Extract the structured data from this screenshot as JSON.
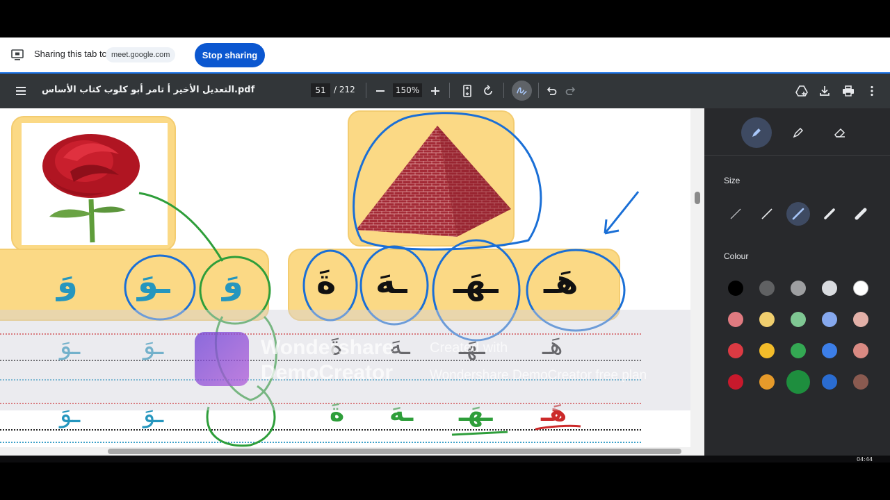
{
  "share_bar": {
    "label": "Sharing this tab to",
    "domain": "meet.google.com",
    "stop_button": "Stop sharing"
  },
  "toolbar": {
    "title": "التعديل الأخير أ تامر أبو كلوب كتاب الأساس.pdf",
    "page_current": "51",
    "page_total": "/ 212",
    "zoom": "150%",
    "icons": [
      "menu-icon",
      "zoom-out-icon",
      "zoom-in-icon",
      "fit-page-icon",
      "rotate-icon",
      "annotate-icon",
      "undo-icon",
      "redo-icon",
      "add-drive-icon",
      "download-icon",
      "print-icon",
      "more-icon"
    ]
  },
  "side_panel": {
    "tools": [
      "pen-icon",
      "highlighter-icon",
      "eraser-icon"
    ],
    "size_label": "Size",
    "colour_label": "Colour",
    "selected_size": 3,
    "colours": [
      [
        "#000000",
        "#606163",
        "#9e9fa1",
        "#dadce0",
        "#ffffff"
      ],
      [
        "#e07a80",
        "#f0ce6e",
        "#7fc793",
        "#86a8ee",
        "#e2b0a8"
      ],
      [
        "#dc3a43",
        "#f3bc2a",
        "#34a853",
        "#3c7ee8",
        "#d98a83"
      ],
      [
        "#c8192c",
        "#e69a2a",
        "#1e8e3e",
        "#2a6cd1",
        "#8a5a50"
      ]
    ],
    "selected_colour": "#1e8e3e"
  },
  "page_content": {
    "cards_row1": [
      "هَـ",
      "ـهَـ",
      "ـهَ",
      "ةَ"
    ],
    "cards_row2": [
      "وَ",
      "ـوَ",
      "وَ"
    ],
    "trace_black": [
      "هَـ",
      "ـهَـ",
      "ـهَ",
      "ةَ"
    ],
    "trace_green": [
      "هَـ",
      "ـهَـ",
      "ـهَ",
      "ةَ"
    ],
    "trace_blue": [
      "ـوَ",
      "ـوَ"
    ],
    "watermark_line1": "Wondershare",
    "watermark_line2": "DemoCreator",
    "watermark_right1": "Created with",
    "watermark_right2": "Wondershare DemoCreator free plan"
  },
  "taskbar": {
    "clock": "04:44"
  }
}
